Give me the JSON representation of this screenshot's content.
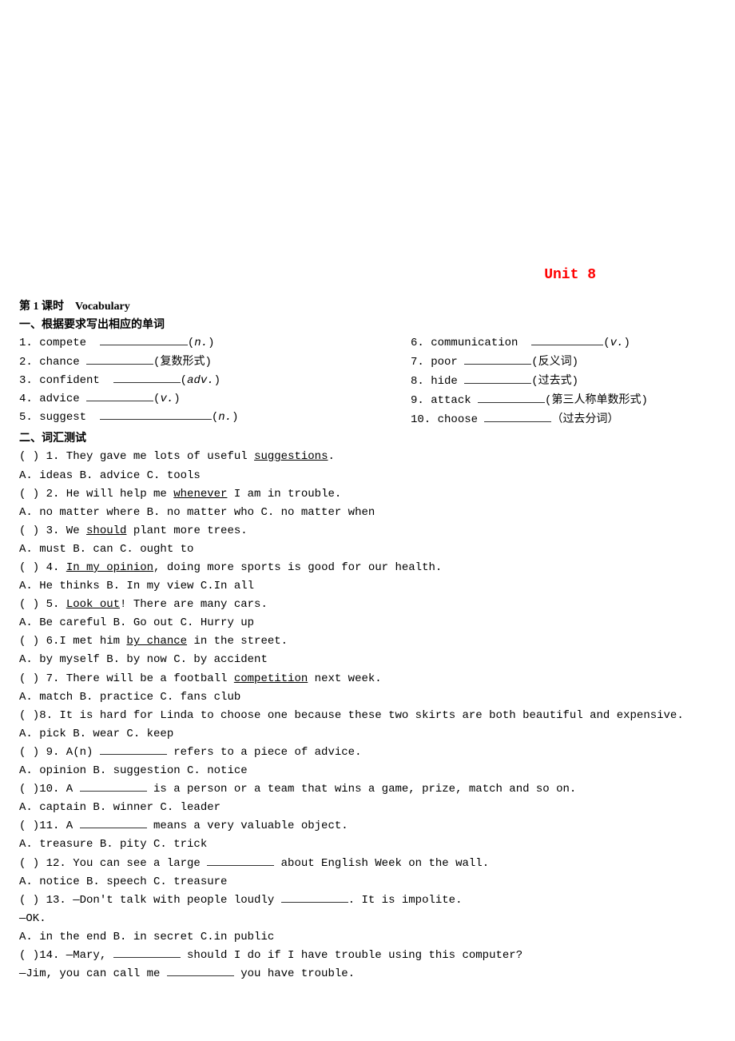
{
  "unit_title": "Unit 8",
  "lesson_title": "第 1 课时　Vocabulary",
  "section1": {
    "title": "一、根据要求写出相应的单词",
    "left": [
      {
        "num": "1.",
        "word": "compete",
        "hint_pre": "(",
        "hint_it": "n.",
        "hint_post": ")"
      },
      {
        "num": "2.",
        "word": "chance",
        "hint_pre": "(",
        "hint": "复数形式",
        "hint_post": ")"
      },
      {
        "num": "3.",
        "word": "confident",
        "hint_pre": "(",
        "hint_it": "adv.",
        "hint_post": ")"
      },
      {
        "num": "4.",
        "word": "advice",
        "hint_pre": "(",
        "hint_it": "v.",
        "hint_post": ")"
      },
      {
        "num": "5.",
        "word": "suggest",
        "hint_pre": "(",
        "hint_it": "n.",
        "hint_post": ")"
      }
    ],
    "right": [
      {
        "num": "6.",
        "word": "communication",
        "hint_pre": "(",
        "hint_it": "v.",
        "hint_post": ")"
      },
      {
        "num": "7.",
        "word": "poor ",
        "hint_pre": "(",
        "hint": "反义词",
        "hint_post": ")"
      },
      {
        "num": "8.",
        "word": "hide  ",
        "hint_pre": "(",
        "hint": "过去式",
        "hint_post": ")"
      },
      {
        "num": "9.",
        "word": "attack",
        "hint_pre": "(",
        "hint": "第三人称单数形式",
        "hint_post": ")"
      },
      {
        "num": "10.",
        "word": "choose ",
        "hint_pre": "（",
        "hint": "过去分词",
        "hint_post": "）"
      }
    ]
  },
  "section2": {
    "title": "二、词汇测试",
    "q": [
      {
        "stem_parts": [
          {
            "t": "(   ) 1. They gave me lots of useful "
          },
          {
            "u": "suggestions"
          },
          {
            "t": "."
          }
        ],
        "opts": "A. ideas   B. advice   C. tools"
      },
      {
        "stem_parts": [
          {
            "t": "(   ) 2. He will help me "
          },
          {
            "u": "whenever"
          },
          {
            "t": " I am in trouble."
          }
        ],
        "opts": "A. no matter where   B. no matter who   C. no matter when"
      },
      {
        "stem_parts": [
          {
            "t": "(   ) 3. We "
          },
          {
            "u": "should"
          },
          {
            "t": " plant more trees."
          }
        ],
        "opts": "A. must   B. can   C. ought to"
      },
      {
        "stem_parts": [
          {
            "t": "(   ) 4. "
          },
          {
            "u": "In my opinion"
          },
          {
            "t": ", doing more sports is good for our health."
          }
        ],
        "opts": "A. He thinks   B. In my view   C.In all"
      },
      {
        "stem_parts": [
          {
            "t": "(   ) 5. "
          },
          {
            "u": "Look out"
          },
          {
            "t": "! There are many cars."
          }
        ],
        "opts": "A. Be careful   B. Go out   C. Hurry up"
      },
      {
        "stem_parts": [
          {
            "t": "(   ) 6.I met him "
          },
          {
            "u": "by chance"
          },
          {
            "t": " in the street."
          }
        ],
        "opts": "A. by myself   B. by now   C. by accident"
      },
      {
        "stem_parts": [
          {
            "t": "(   ) 7. There will be a football "
          },
          {
            "u": "competition"
          },
          {
            "t": " next week."
          }
        ],
        "opts": "A. match   B. practice   C. fans club"
      },
      {
        "stem_parts": [
          {
            "t": "(   )8. It is hard for Linda to choose one because these two skirts are both beautiful and expensive."
          }
        ],
        "opts": "A. pick   B. wear   C. keep"
      },
      {
        "stem_parts": [
          {
            "t": " (   ) 9. A(n) "
          },
          {
            "b": "w8"
          },
          {
            "t": " refers to a piece of advice."
          }
        ],
        "opts": "A. opinion   B. suggestion   C. notice"
      },
      {
        "stem_parts": [
          {
            "t": "(   )10. A "
          },
          {
            "b": "w8"
          },
          {
            "t": " is a person or a team that wins a game, prize, match and so on."
          }
        ],
        "opts": "A. captain   B. winner   C. leader"
      },
      {
        "stem_parts": [
          {
            "t": "(   )11. A "
          },
          {
            "b": "w8"
          },
          {
            "t": " means a very valuable object."
          }
        ],
        "opts": "A. treasure   B. pity   C. trick"
      },
      {
        "stem_parts": [
          {
            "t": "(   ) 12. You can see a large "
          },
          {
            "b": "w8"
          },
          {
            "t": " about English Week on the wall."
          }
        ],
        "opts": "A. notice   B. speech   C. treasure"
      },
      {
        "stem_parts": [
          {
            "t": "(   ) 13. —Don't talk with people loudly "
          },
          {
            "b": "w8"
          },
          {
            "t": ". It is impolite."
          }
        ],
        "extra": "—OK.",
        "opts": "A. in the end    B. in secret   C.in public"
      },
      {
        "stem_parts": [
          {
            "t": "(   )14. —Mary, "
          },
          {
            "b": "w8"
          },
          {
            "t": " should I do if I have trouble using this computer?"
          }
        ],
        "extra_parts": [
          {
            "t": "—Jim, you can call me "
          },
          {
            "b": "w8"
          },
          {
            "t": " you have trouble."
          }
        ]
      }
    ]
  }
}
